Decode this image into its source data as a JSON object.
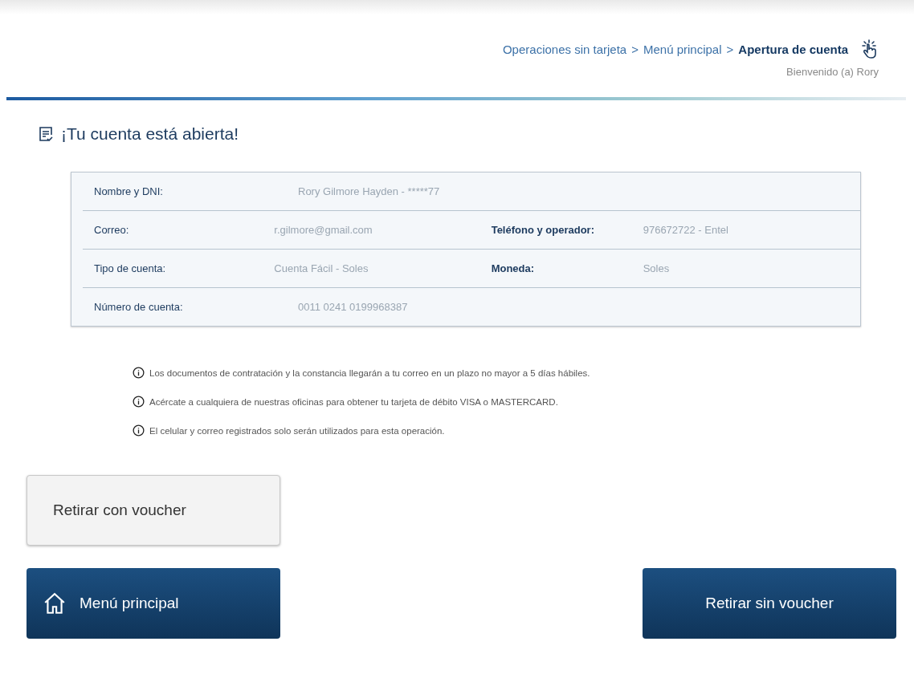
{
  "header": {
    "breadcrumb": {
      "separator": ">",
      "items": [
        {
          "label": "Operaciones sin tarjeta",
          "current": false
        },
        {
          "label": "Menú principal",
          "current": false
        },
        {
          "label": "Apertura de cuenta",
          "current": true
        }
      ]
    },
    "welcome": "Bienvenido (a) Rory"
  },
  "title": "¡Tu cuenta está abierta!",
  "summary": {
    "rows": [
      {
        "fields": [
          {
            "label": "Nombre y  DNI:",
            "value": "Rory Gilmore Hayden - *****77"
          }
        ]
      },
      {
        "fields": [
          {
            "label": "Correo:",
            "value": "r.gilmore@gmail.com"
          },
          {
            "label": "Teléfono y operador:",
            "value": "976672722 - Entel"
          }
        ]
      },
      {
        "fields": [
          {
            "label": "Tipo de cuenta:",
            "value": "Cuenta Fácil - Soles"
          },
          {
            "label": "Moneda:",
            "value": "Soles"
          }
        ]
      },
      {
        "fields": [
          {
            "label": "Número de cuenta:",
            "value": "0011 0241 0199968387"
          }
        ]
      }
    ]
  },
  "notes": [
    "Los documentos de contratación y la constancia llegarán a tu correo en un plazo no mayor a 5 días hábiles.",
    "Acércate a cualquiera de nuestras oficinas para obtener tu tarjeta de débito VISA o MASTERCARD.",
    "El celular y correo registrados solo serán utilizados para esta operación."
  ],
  "buttons": [
    {
      "label": "Retirar con voucher",
      "kind": "secondary"
    },
    {
      "label": "Menú principal",
      "kind": "home"
    },
    {
      "label": "Retirar sin voucher",
      "kind": "primary"
    }
  ]
}
